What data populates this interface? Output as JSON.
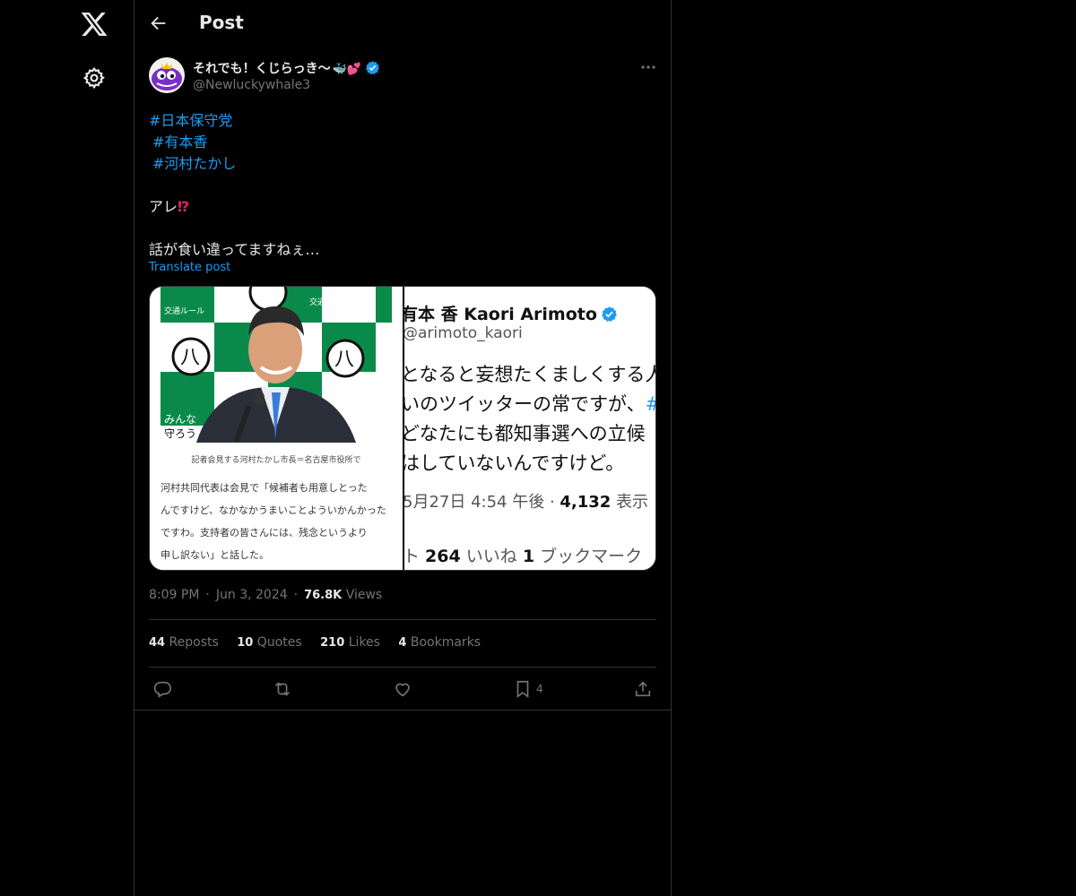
{
  "header": {
    "title": "Post"
  },
  "post": {
    "display_name": "それでも！くじらっき〜",
    "display_name_emoji": "🐳💕",
    "handle": "@Newluckywhale3",
    "hashtags": [
      "#日本保守党",
      "#有本香",
      "#河村たかし"
    ],
    "line1": "アレ",
    "line1_emoji": "⁉",
    "line2": "話が食い違ってますねぇ…",
    "translate": "Translate post",
    "time": "8:09 PM",
    "date": "Jun 3, 2024",
    "views_count": "76.8K",
    "views_label": "Views"
  },
  "media": {
    "left_caption": "記者会見する河村たかし市長＝名古屋市役所で",
    "left_article": [
      "河村共同代表は会見で「候補者も用意しとった",
      "んですけど、なかなかうまいことよういかんかった",
      "ですわ。支持者の皆さんには、残念というより",
      "申し訳ない」と話した。"
    ],
    "left_sign_1": "交通ルール",
    "left_sign_2": "みんな",
    "left_sign_3": "守ろう",
    "right_name": "有本 香  Kaori Arimoto",
    "right_handle": "@arimoto_kaori",
    "right_body_1": "となると妄想たくましくする人",
    "right_body_2": "いのツイッターの常ですが、",
    "right_body_2_tag": "#日",
    "right_body_3": "どなたにも都知事選への立候",
    "right_body_4": "はしていないんですけど。",
    "right_meta": "5月27日 4:54 午後 · ",
    "right_meta_count": "4,132",
    "right_meta_label": " 表示",
    "right_stats_1": "ト   ",
    "right_likes": "264",
    "right_likes_label": " いいね   ",
    "right_bm": "1",
    "right_bm_label": " ブックマーク"
  },
  "stats": {
    "reposts": "44",
    "reposts_label": "Reposts",
    "quotes": "10",
    "quotes_label": "Quotes",
    "likes": "210",
    "likes_label": "Likes",
    "bookmarks": "4",
    "bookmarks_label": "Bookmarks"
  },
  "actions": {
    "bookmark_count": "4"
  },
  "colors": {
    "accent": "#1d9bf0",
    "background": "#000000",
    "border": "#2f3336",
    "muted": "#71767b"
  },
  "icons": [
    "x-logo-icon",
    "gear-icon",
    "back-arrow-icon",
    "verified-icon",
    "more-icon",
    "reply-icon",
    "repost-icon",
    "like-icon",
    "bookmark-icon",
    "share-icon"
  ]
}
